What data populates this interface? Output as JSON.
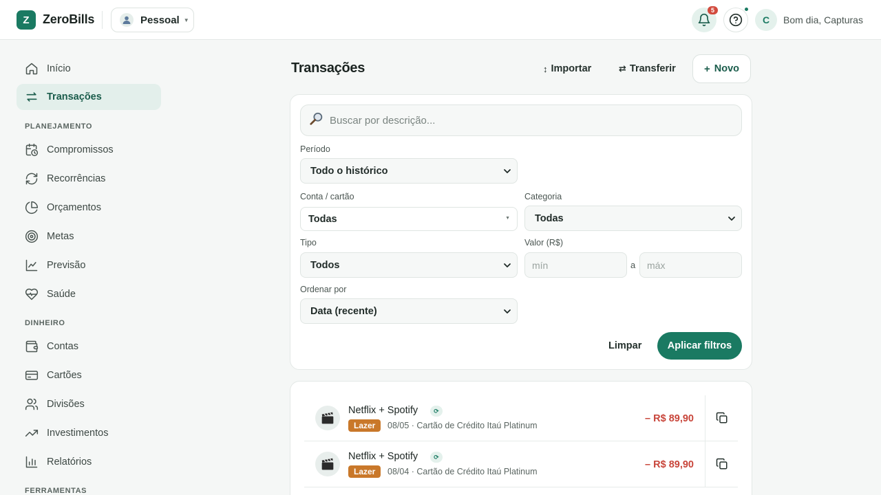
{
  "header": {
    "logo_letter": "Z",
    "brand": "ZeroBills",
    "profile_label": "Pessoal",
    "notifications_count": "5",
    "user_initial": "C",
    "greeting": "Bom dia, Capturas"
  },
  "sidebar": {
    "inicio": "Início",
    "transacoes": "Transações",
    "section_planejamento": "PLANEJAMENTO",
    "compromissos": "Compromissos",
    "recorrencias": "Recorrências",
    "orcamentos": "Orçamentos",
    "metas": "Metas",
    "previsao": "Previsão",
    "saude": "Saúde",
    "section_dinheiro": "DINHEIRO",
    "contas": "Contas",
    "cartoes": "Cartões",
    "divisoes": "Divisões",
    "investimentos": "Investimentos",
    "relatorios": "Relatórios",
    "section_ferramentas": "FERRAMENTAS"
  },
  "main": {
    "title": "Transações",
    "importar": "Importar",
    "transferir": "Transferir",
    "novo": "Novo",
    "search_placeholder": "Buscar por descrição...",
    "periodo_label": "Período",
    "periodo_value": "Todo o histórico",
    "conta_label": "Conta / cartão",
    "conta_value": "Todas",
    "categoria_label": "Categoria",
    "categoria_value": "Todas",
    "tipo_label": "Tipo",
    "tipo_value": "Todos",
    "valor_label": "Valor (R$)",
    "valor_min_placeholder": "mín",
    "valor_sep": "a",
    "valor_max_placeholder": "máx",
    "ordenar_label": "Ordenar por",
    "ordenar_value": "Data (recente)",
    "limpar": "Limpar",
    "aplicar": "Aplicar filtros"
  },
  "transactions": [
    {
      "description": "Netflix + Spotify",
      "category": "Lazer",
      "meta": "08/05 · Cartão de Crédito Itaú Platinum",
      "amount": "– R$ 89,90",
      "icon": "clapperboard-icon"
    },
    {
      "description": "Netflix + Spotify",
      "category": "Lazer",
      "meta": "08/04 · Cartão de Crédito Itaú Platinum",
      "amount": "– R$ 89,90",
      "icon": "clapperboard-icon"
    }
  ],
  "colors": {
    "accent": "#1a7a62",
    "expense": "#c8453a",
    "category_lazer": "#c9782a"
  }
}
